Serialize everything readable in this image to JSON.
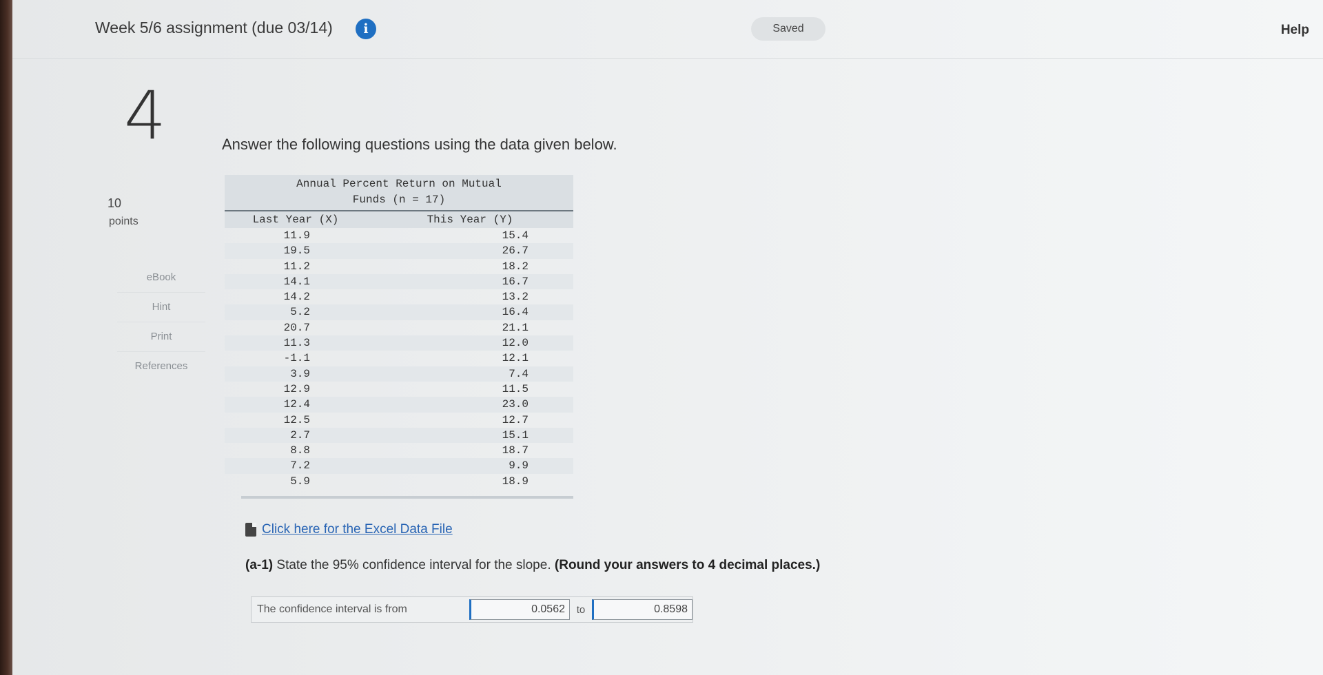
{
  "header": {
    "assignment_title": "Week 5/6 assignment (due 03/14)",
    "save_status": "Saved",
    "help_label": "Help"
  },
  "question": {
    "number": "4",
    "points_value": "10",
    "points_label": "points",
    "prompt": "Answer the following questions using the data given below.",
    "sub_label": "(a-1)",
    "sub_text": "State the 95% confidence interval for the slope.",
    "instruction": "(Round your answers to 4 decimal places.)"
  },
  "side_tools": [
    {
      "label": "eBook"
    },
    {
      "label": "Hint"
    },
    {
      "label": "Print"
    },
    {
      "label": "References"
    }
  ],
  "table": {
    "caption_line1": "Annual Percent Return on Mutual",
    "caption_line2": "Funds (n = 17)",
    "col_x": "Last Year (X)",
    "col_y": "This Year (Y)",
    "rows": [
      [
        "11.9",
        "15.4"
      ],
      [
        "19.5",
        "26.7"
      ],
      [
        "11.2",
        "18.2"
      ],
      [
        "14.1",
        "16.7"
      ],
      [
        "14.2",
        "13.2"
      ],
      [
        "5.2",
        "16.4"
      ],
      [
        "20.7",
        "21.1"
      ],
      [
        "11.3",
        "12.0"
      ],
      [
        "-1.1",
        "12.1"
      ],
      [
        "3.9",
        "7.4"
      ],
      [
        "12.9",
        "11.5"
      ],
      [
        "12.4",
        "23.0"
      ],
      [
        "12.5",
        "12.7"
      ],
      [
        "2.7",
        "15.1"
      ],
      [
        "8.8",
        "18.7"
      ],
      [
        "7.2",
        "9.9"
      ],
      [
        "5.9",
        "18.9"
      ]
    ]
  },
  "excel_link": "Click here for the Excel Data File",
  "answer": {
    "label": "The confidence interval is from",
    "lower": "0.0562",
    "separator": "to",
    "upper": "0.8598"
  }
}
